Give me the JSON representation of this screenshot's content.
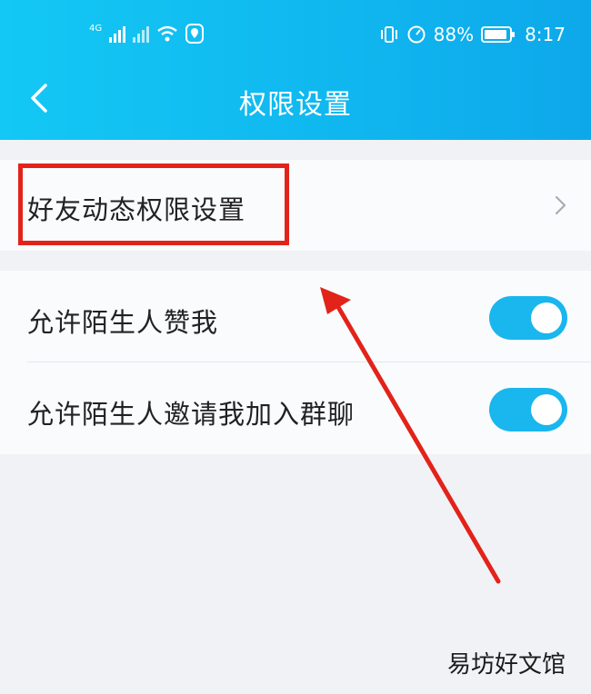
{
  "status_bar": {
    "network_label": "4G",
    "battery": "88%",
    "time": "8:17"
  },
  "header": {
    "title": "权限设置"
  },
  "sections": {
    "friend_feed": {
      "label": "好友动态权限设置"
    },
    "toggles": [
      {
        "label": "允许陌生人赞我",
        "on": true
      },
      {
        "label": "允许陌生人邀请我加入群聊",
        "on": true
      }
    ]
  },
  "watermark": "易坊好文馆",
  "colors": {
    "accent": "#1ab6ee",
    "header": "#10b6ef",
    "annotation": "#e2231a"
  }
}
